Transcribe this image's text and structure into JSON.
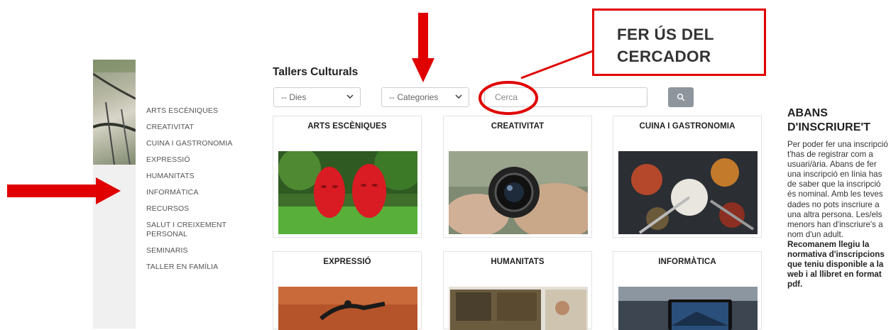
{
  "sidebar": {
    "items": [
      {
        "label": "ARTS ESCÈNIQUES"
      },
      {
        "label": "CREATIVITAT"
      },
      {
        "label": "CUINA I GASTRONOMIA"
      },
      {
        "label": "EXPRESSIÓ"
      },
      {
        "label": "HUMANITATS"
      },
      {
        "label": "INFORMÀTICA"
      },
      {
        "label": "RECURSOS"
      },
      {
        "label": "SALUT I CREIXEMENT PERSONAL"
      },
      {
        "label": "SEMINARIS"
      },
      {
        "label": "TALLER EN FAMÍLIA"
      }
    ]
  },
  "main": {
    "title": "Tallers Culturals",
    "filters": {
      "days": {
        "selected": "-- Dies"
      },
      "categories": {
        "selected": "-- Categories"
      },
      "search": {
        "placeholder": "Cerca",
        "value": ""
      }
    },
    "cards": [
      {
        "title": "ARTS ESCÈNIQUES"
      },
      {
        "title": "CREATIVITAT"
      },
      {
        "title": "CUINA I GASTRONOMIA"
      },
      {
        "title": "EXPRESSIÓ"
      },
      {
        "title": "HUMANITATS"
      },
      {
        "title": "INFORMÀTICA"
      }
    ]
  },
  "annotation": {
    "callout_line1": "FER ÚS DEL",
    "callout_line2": "CERCADOR",
    "color": "#e00000"
  },
  "info": {
    "title_line1": "ABANS",
    "title_line2": "D'INSCRIURE'T",
    "body": "Per poder fer una inscripció t'has de registrar com a usuari/ària. Abans de fer una inscripció en línia has de saber que la inscripció és nominal. Amb les teves dades no pots inscriure a una altra persona. Les/els menors han d'inscriure's a nom d'un adult.",
    "bold": "Recomanem llegiu la normativa d'inscripcions que teniu disponible a la web i al llibret en format pdf."
  }
}
